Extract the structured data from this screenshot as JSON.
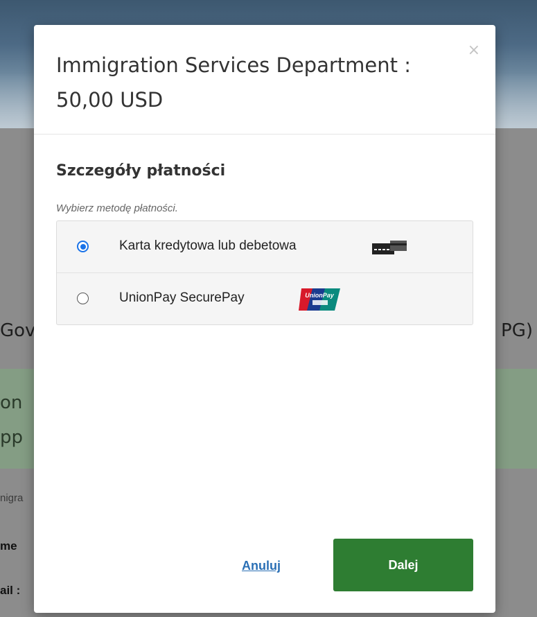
{
  "background": {
    "heading_left": "Gov",
    "heading_right": "PG)",
    "green_line1": "on",
    "green_line2": "pp",
    "text_line1": "nigra",
    "text_line2": "me",
    "text_line3": "ail :"
  },
  "modal": {
    "title": "Immigration Services Department : 50,00 USD",
    "close_label": "×",
    "section_title": "Szczegóły płatności",
    "hint": "Wybierz metodę płatności.",
    "methods": [
      {
        "label": "Karta kredytowa lub debetowa",
        "selected": true,
        "icon": "credit-card-icon"
      },
      {
        "label": "UnionPay SecurePay",
        "selected": false,
        "icon": "unionpay-logo"
      }
    ],
    "cancel_label": "Anuluj",
    "next_label": "Dalej"
  },
  "colors": {
    "primary_button": "#2e7d32",
    "link": "#2a6fb5",
    "radio_selected": "#1a73e8"
  }
}
